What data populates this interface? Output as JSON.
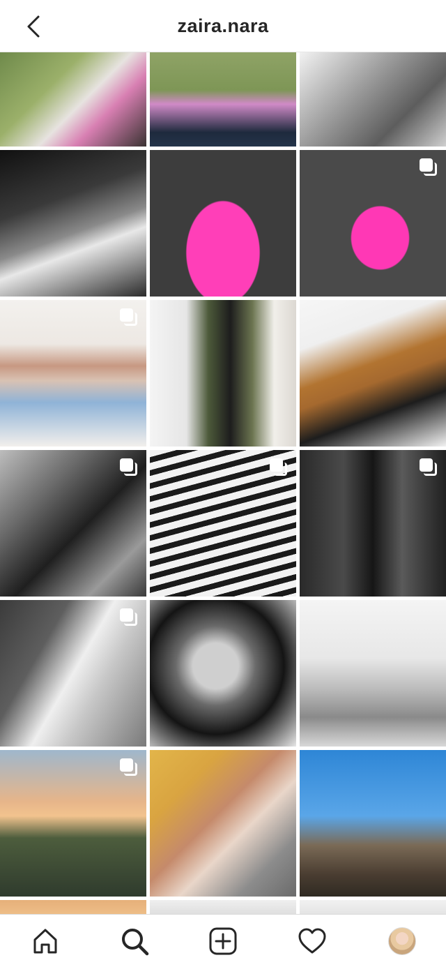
{
  "header": {
    "title": "zaira.nara",
    "back_icon": "chevron-left-icon"
  },
  "grid": {
    "multi_icon": "multiple-photos-icon"
  },
  "nav": {
    "items": [
      {
        "name": "home",
        "icon": "home-icon"
      },
      {
        "name": "search",
        "icon": "search-icon"
      },
      {
        "name": "create",
        "icon": "add-square-icon"
      },
      {
        "name": "activity",
        "icon": "heart-icon"
      },
      {
        "name": "profile",
        "icon": "avatar"
      }
    ]
  },
  "colors": {
    "text": "#262626",
    "background": "#ffffff",
    "divider": "#dbdbdb"
  }
}
